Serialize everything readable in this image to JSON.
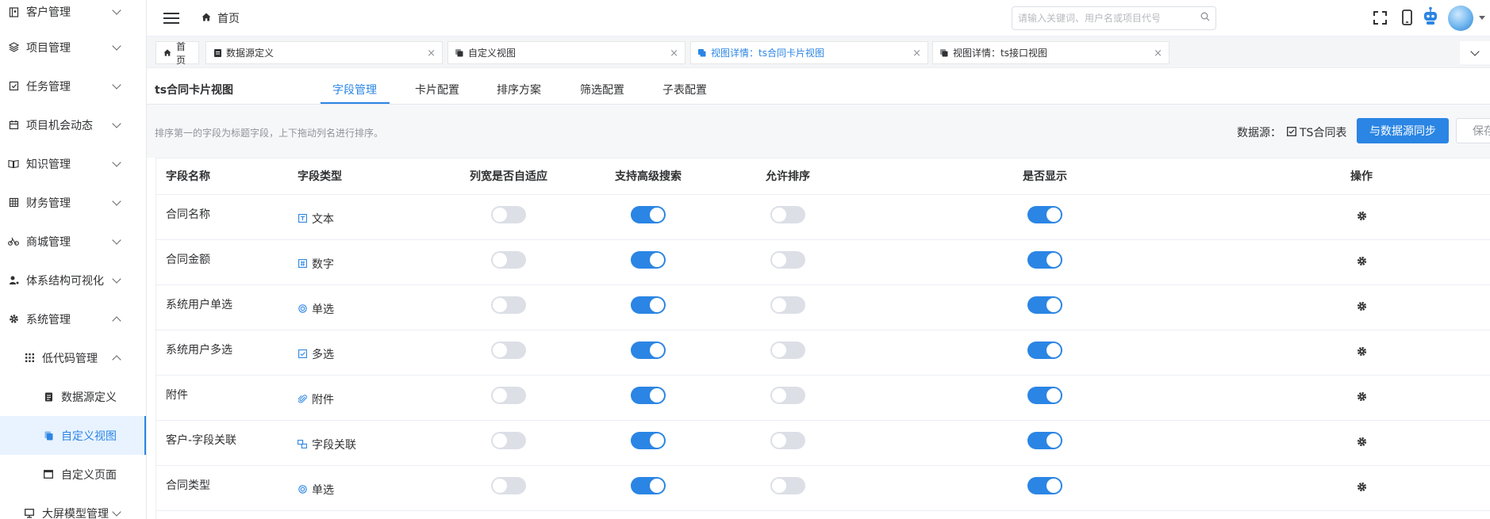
{
  "sidebar": {
    "items": [
      {
        "label": "客户管理",
        "icon": "contacts-icon",
        "level": 1,
        "expanded": false
      },
      {
        "label": "项目管理",
        "icon": "layers-icon",
        "level": 1,
        "expanded": false
      },
      {
        "label": "任务管理",
        "icon": "task-check-icon",
        "level": 1,
        "expanded": false
      },
      {
        "label": "项目机会动态",
        "icon": "calendar-icon",
        "level": 1,
        "expanded": false
      },
      {
        "label": "知识管理",
        "icon": "book-icon",
        "level": 1,
        "expanded": false
      },
      {
        "label": "财务管理",
        "icon": "grid-table-icon",
        "level": 1,
        "expanded": false
      },
      {
        "label": "商城管理",
        "icon": "bike-icon",
        "level": 1,
        "expanded": false
      },
      {
        "label": "体系结构可视化",
        "icon": "user-tree-icon",
        "level": 1,
        "expanded": false
      },
      {
        "label": "系统管理",
        "icon": "gear-icon",
        "level": 1,
        "expanded": true
      },
      {
        "label": "低代码管理",
        "icon": "apps-grid-icon",
        "level": 2,
        "expanded": true
      },
      {
        "label": "数据源定义",
        "icon": "document-icon",
        "level": 3
      },
      {
        "label": "自定义视图",
        "icon": "copy-icon",
        "level": 3,
        "active": true
      },
      {
        "label": "自定义页面",
        "icon": "window-icon",
        "level": 3
      },
      {
        "label": "大屏模型管理",
        "icon": "monitor-icon",
        "level": 2,
        "expanded": false
      }
    ]
  },
  "header": {
    "breadcrumb": "首页",
    "search_placeholder": "请输入关键词、用户名或项目代号"
  },
  "tabs": [
    {
      "label": "首页",
      "closable": false,
      "active": false
    },
    {
      "label": "数据源定义",
      "closable": true,
      "active": false
    },
    {
      "label": "自定义视图",
      "closable": true,
      "active": false
    },
    {
      "label": "视图详情：ts合同卡片视图",
      "closable": true,
      "active": true
    },
    {
      "label": "视图详情：ts接口视图",
      "closable": true,
      "active": false
    }
  ],
  "view": {
    "title": "ts合同卡片视图",
    "subtabs": [
      "字段管理",
      "卡片配置",
      "排序方案",
      "筛选配置",
      "子表配置"
    ],
    "active_subtab": 0,
    "hint": "排序第一的字段为标题字段，上下拖动列名进行排序。",
    "datasource_label": "数据源：",
    "datasource_value": "TS合同表",
    "sync_button": "与数据源同步",
    "save_button": "保存"
  },
  "table": {
    "columns": [
      "字段名称",
      "字段类型",
      "列宽是否自适应",
      "支持高级搜索",
      "允许排序",
      "是否显示",
      "操作"
    ],
    "rows": [
      {
        "name": "合同名称",
        "type": "文本",
        "type_icon": "text-icon",
        "autowidth": false,
        "search": true,
        "sort": false,
        "show": true
      },
      {
        "name": "合同金额",
        "type": "数字",
        "type_icon": "number-icon",
        "autowidth": false,
        "search": true,
        "sort": false,
        "show": true
      },
      {
        "name": "系统用户单选",
        "type": "单选",
        "type_icon": "radio-icon",
        "autowidth": false,
        "search": true,
        "sort": false,
        "show": true
      },
      {
        "name": "系统用户多选",
        "type": "多选",
        "type_icon": "checkbox-icon",
        "autowidth": false,
        "search": true,
        "sort": false,
        "show": true
      },
      {
        "name": "附件",
        "type": "附件",
        "type_icon": "paperclip-icon",
        "autowidth": false,
        "search": true,
        "sort": false,
        "show": true
      },
      {
        "name": "客户-字段关联",
        "type": "字段关联",
        "type_icon": "link-icon",
        "autowidth": false,
        "search": true,
        "sort": false,
        "show": true
      },
      {
        "name": "合同类型",
        "type": "单选",
        "type_icon": "radio-icon",
        "autowidth": false,
        "search": true,
        "sort": false,
        "show": true
      }
    ]
  },
  "colors": {
    "accent": "#2b85e4",
    "switch_off": "#dcdfe6",
    "active_menu_bg": "#e8f3ff"
  }
}
